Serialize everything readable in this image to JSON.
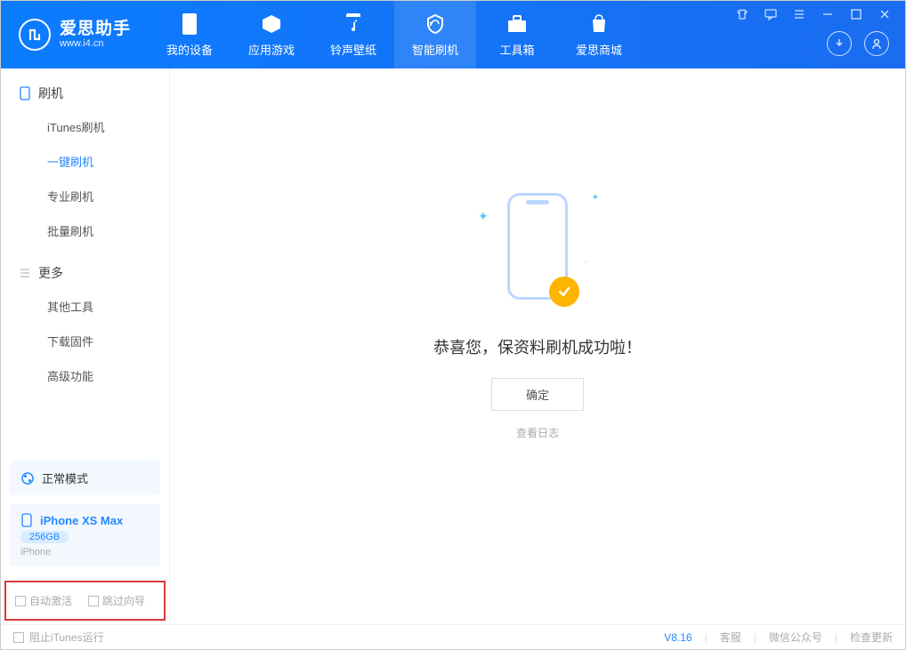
{
  "app": {
    "title": "爱思助手",
    "subtitle": "www.i4.cn"
  },
  "nav": {
    "tabs": [
      {
        "label": "我的设备",
        "icon": "device-icon"
      },
      {
        "label": "应用游戏",
        "icon": "apps-icon"
      },
      {
        "label": "铃声壁纸",
        "icon": "music-icon"
      },
      {
        "label": "智能刷机",
        "icon": "flash-icon",
        "active": true
      },
      {
        "label": "工具箱",
        "icon": "toolbox-icon"
      },
      {
        "label": "爱思商城",
        "icon": "shop-icon"
      }
    ]
  },
  "sidebar": {
    "section1": {
      "title": "刷机"
    },
    "items1": [
      {
        "label": "iTunes刷机"
      },
      {
        "label": "一键刷机",
        "active": true
      },
      {
        "label": "专业刷机"
      },
      {
        "label": "批量刷机"
      }
    ],
    "section2": {
      "title": "更多"
    },
    "items2": [
      {
        "label": "其他工具"
      },
      {
        "label": "下载固件"
      },
      {
        "label": "高级功能"
      }
    ],
    "mode": {
      "label": "正常模式"
    },
    "device": {
      "name": "iPhone XS Max",
      "storage": "256GB",
      "type": "iPhone"
    },
    "opts": {
      "auto_activate": "自动激活",
      "skip_guide": "跳过向导"
    }
  },
  "main": {
    "success_text": "恭喜您，保资料刷机成功啦！",
    "ok_label": "确定",
    "log_label": "查看日志"
  },
  "footer": {
    "block_itunes": "阻止iTunes运行",
    "version": "V8.16",
    "links": [
      "客服",
      "微信公众号",
      "检查更新"
    ]
  }
}
